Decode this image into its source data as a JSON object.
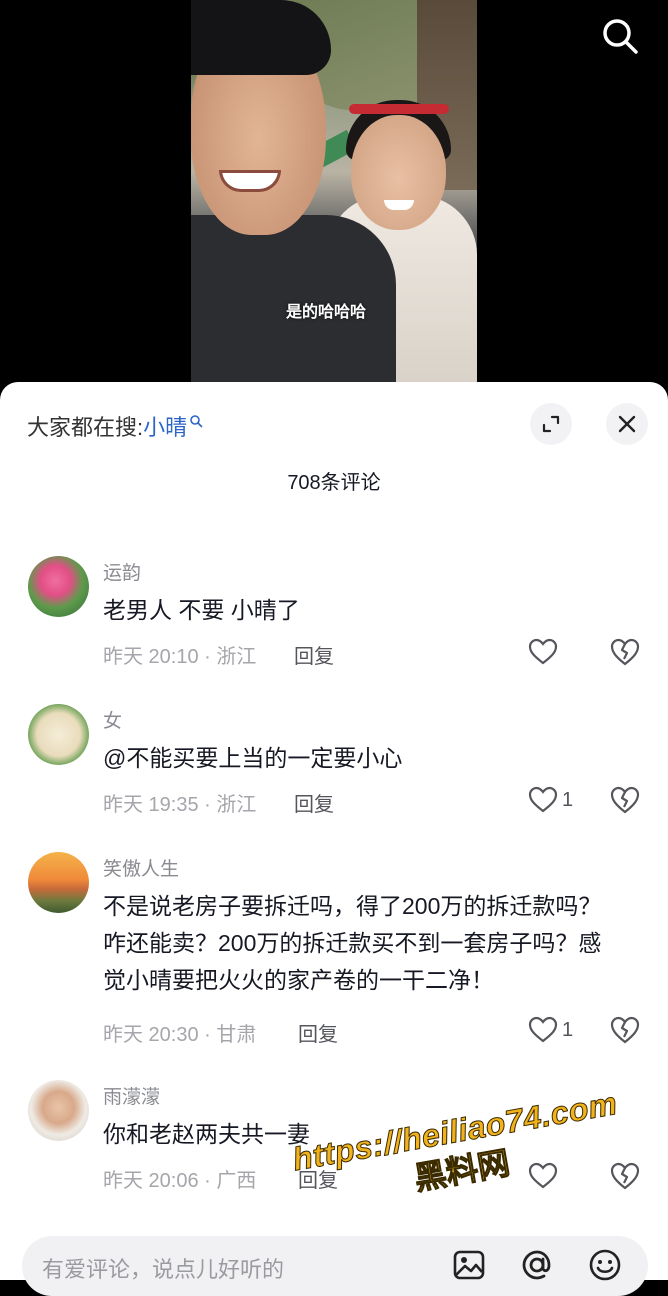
{
  "video": {
    "subtitle": "是的哈哈哈"
  },
  "sheet": {
    "hot_search_prefix": "大家都在搜:",
    "hot_search_keyword": "小晴",
    "comment_count": "708条评论"
  },
  "comments": [
    {
      "user": "运韵",
      "text": "老男人 不要 小晴了",
      "meta": "昨天 20:10 · 浙江",
      "reply": "回复",
      "likes": ""
    },
    {
      "user": "女",
      "text": "@不能买要上当的一定要小心",
      "meta": "昨天 19:35 · 浙江",
      "reply": "回复",
      "likes": "1"
    },
    {
      "user": "笑傲人生",
      "text": "不是说老房子要拆迁吗，得了200万的拆迁款吗？咋还能卖？200万的拆迁款买不到一套房子吗？感觉小晴要把火火的家产卷的一干二净！",
      "meta": "昨天 20:30 · 甘肃",
      "reply": "回复",
      "likes": "1"
    },
    {
      "user": "雨濛濛",
      "text": "你和老赵两夫共一妻",
      "meta": "昨天 20:06 · 广西",
      "reply": "回复",
      "likes": ""
    }
  ],
  "watermark": {
    "url": "https://heiliao74.com",
    "name": "黑料网"
  },
  "input": {
    "placeholder": "有爱评论，说点儿好听的"
  },
  "icons": {
    "search": "search-icon",
    "expand": "expand-icon",
    "close": "close-icon",
    "like": "heart-icon",
    "dislike": "broken-heart-icon",
    "image": "image-icon",
    "mention": "at-icon",
    "emoji": "emoji-icon"
  },
  "colors": {
    "keyword": "#2b66c7",
    "watermark": "#f2b21c"
  }
}
